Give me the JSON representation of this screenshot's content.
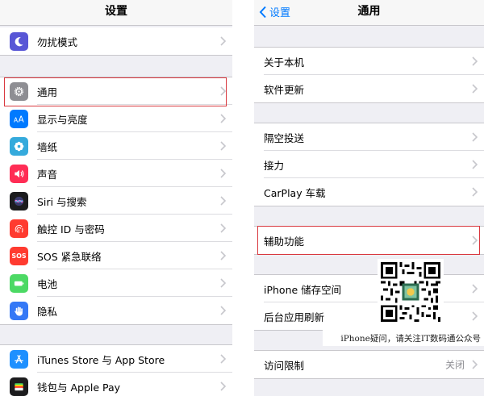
{
  "left": {
    "title": "设置",
    "items": [
      {
        "label": "勿扰模式",
        "icon": "moon-icon",
        "color": "#5856d6"
      },
      {
        "label": "通用",
        "icon": "gear-icon",
        "color": "#8e8e93"
      },
      {
        "label": "显示与亮度",
        "icon": "text-size-icon",
        "color": "#007aff"
      },
      {
        "label": "墙纸",
        "icon": "flower-icon",
        "color": "#35aadc"
      },
      {
        "label": "声音",
        "icon": "speaker-icon",
        "color": "#ff2d55"
      },
      {
        "label": "Siri 与搜索",
        "icon": "siri-icon",
        "color": "#1c1c1e"
      },
      {
        "label": "触控 ID 与密码",
        "icon": "fingerprint-icon",
        "color": "#ff3b30"
      },
      {
        "label": "SOS 紧急联络",
        "icon": "sos-icon",
        "color": "#ff3b30",
        "icon_text": "SOS"
      },
      {
        "label": "电池",
        "icon": "battery-icon",
        "color": "#4cd964"
      },
      {
        "label": "隐私",
        "icon": "hand-icon",
        "color": "#3478f6"
      },
      {
        "label": "iTunes Store 与 App Store",
        "icon": "app-store-icon",
        "color": "#1e90ff"
      },
      {
        "label": "钱包与 Apple Pay",
        "icon": "wallet-icon",
        "color": "#1c1c1e"
      }
    ]
  },
  "right": {
    "back_label": "设置",
    "title": "通用",
    "items": [
      {
        "label": "关于本机"
      },
      {
        "label": "软件更新"
      },
      {
        "label": "隔空投送"
      },
      {
        "label": "接力"
      },
      {
        "label": "CarPlay 车载"
      },
      {
        "label": "辅助功能"
      },
      {
        "label": "iPhone 储存空间"
      },
      {
        "label": "后台应用刷新"
      },
      {
        "label": "访问限制",
        "value": "关闭"
      }
    ]
  },
  "watermark": {
    "caption": "iPhone疑问，请关注IT数码通公众号"
  },
  "colors": {
    "highlight": "#d9383f",
    "accent": "#007aff",
    "group_bg": "#efeff4"
  }
}
